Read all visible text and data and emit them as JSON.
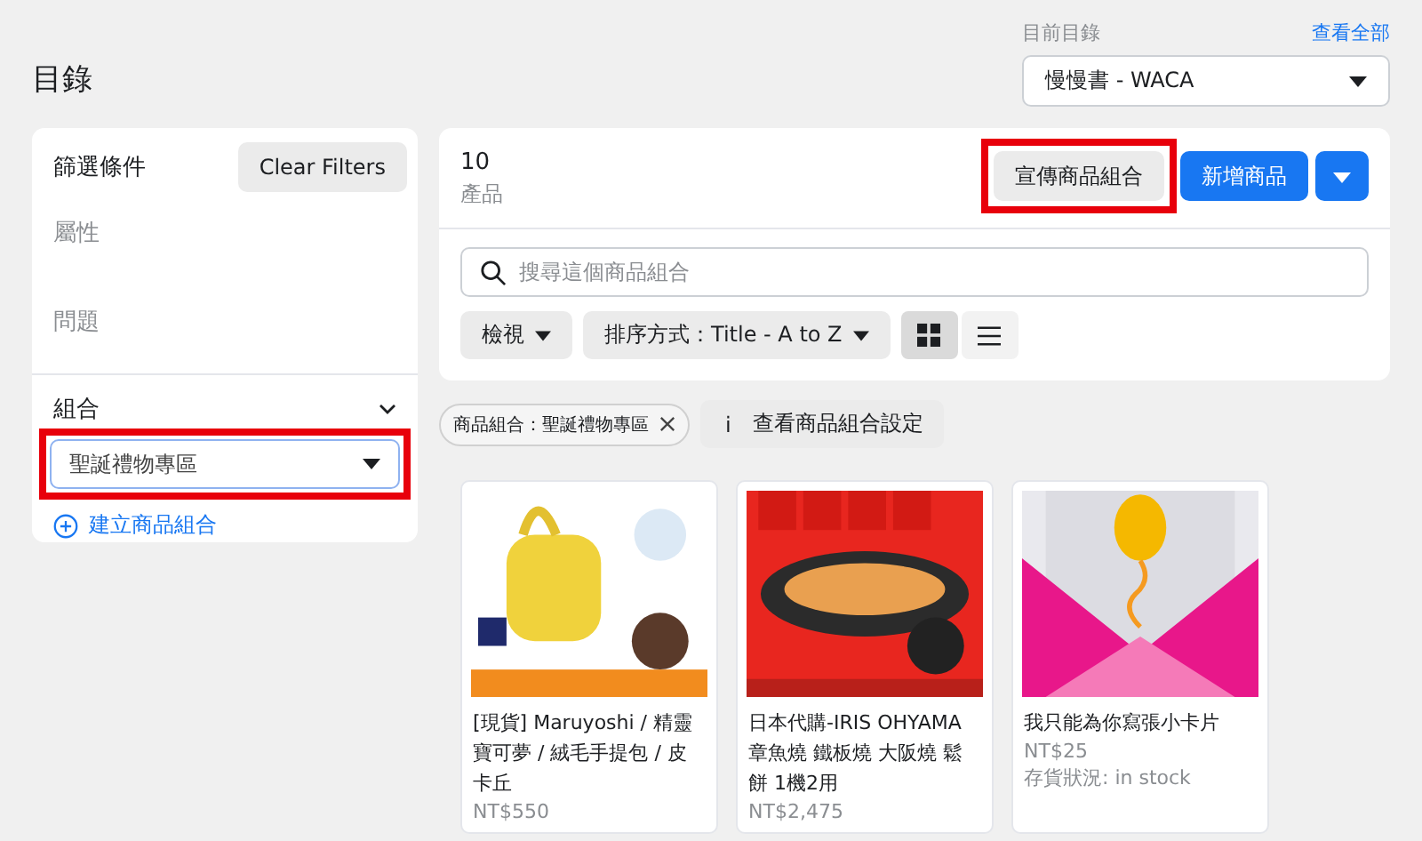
{
  "page_title": "目錄",
  "catalog_picker": {
    "label": "目前目錄",
    "link": "查看全部",
    "value": "慢慢書 - WACA"
  },
  "filters": {
    "title": "篩選條件",
    "clear_button": "Clear Filters",
    "sections": [
      "屬性",
      "問題"
    ],
    "set_section": {
      "title": "組合",
      "expanded": true,
      "dropdown_value": "聖誕禮物專區",
      "highlighted": true,
      "create_link": "建立商品組合"
    }
  },
  "summary": {
    "count": "10",
    "unit": "產品",
    "promote_button": "宣傳商品組合",
    "promote_highlighted": true,
    "add_button": "新增商品"
  },
  "search": {
    "placeholder": "搜尋這個商品組合"
  },
  "toolbar": {
    "view_button": "檢視",
    "sort_button": "排序方式：Title - A to Z",
    "view_modes": [
      {
        "kind": "grid",
        "selected": true
      },
      {
        "kind": "list",
        "selected": false
      }
    ]
  },
  "chips": {
    "filter_chip": "商品組合：聖誕禮物專區",
    "settings_button": "查看商品組合設定",
    "info_icon": "i"
  },
  "products": [
    {
      "title": "[現貨] Maruyoshi / 精靈寶可夢 / 絨毛手提包 / 皮卡丘",
      "price": "NT$550",
      "kind": "picture"
    },
    {
      "title": "日本代購-IRIS OHYAMA 章魚燒 鐵板燒 大阪燒 鬆餅 1機2用",
      "price": "NT$2,475",
      "kind": "picture"
    },
    {
      "title": "我只能為你寫張小卡片",
      "price": "NT$25",
      "stock": "存貨狀況: in stock",
      "kind": "picture"
    }
  ]
}
